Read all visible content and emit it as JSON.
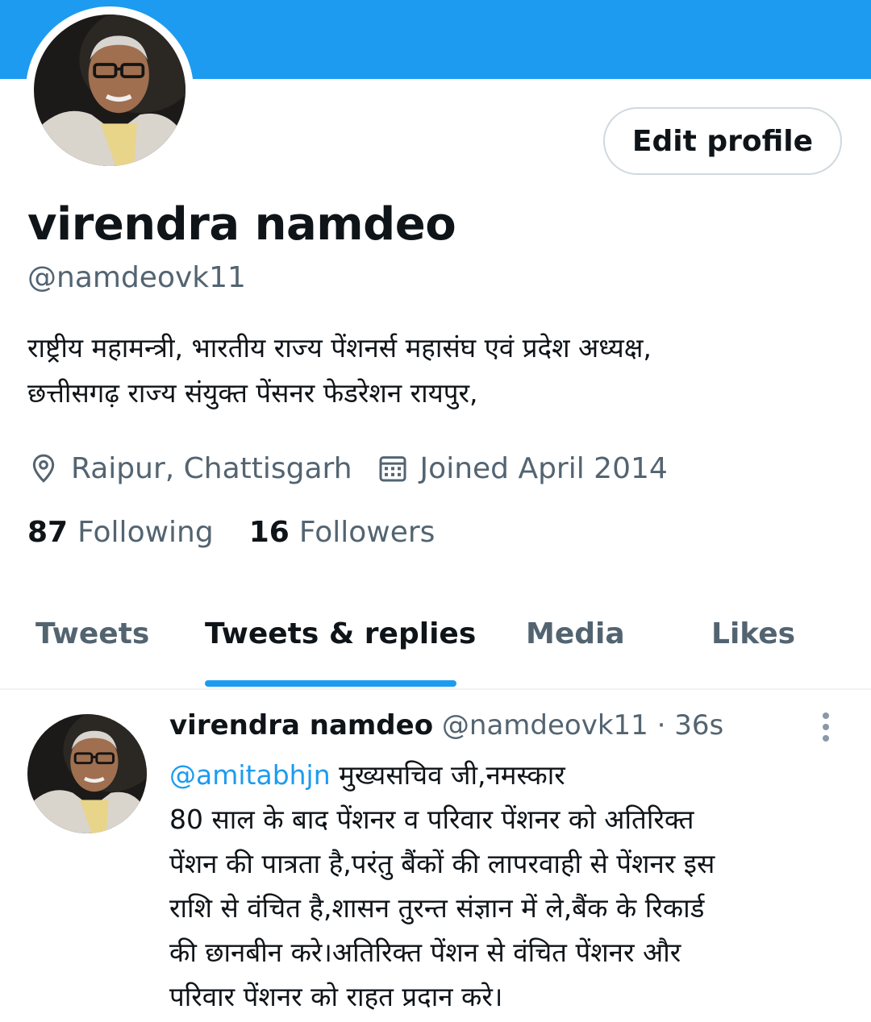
{
  "colors": {
    "accent": "#1d9bf0",
    "text_primary": "#0f1419",
    "text_secondary": "#536471",
    "border": "#cfd9de"
  },
  "profile": {
    "display_name": "virendra namdeo",
    "handle": "@namdeovk11",
    "edit_button_label": "Edit profile",
    "bio_lines": [
      "राष्ट्रीय महामन्त्री, भारतीय राज्य पेंशनर्स महासंघ  एवं प्रदेश अध्यक्ष,",
      "छत्तीसगढ़ राज्य संयुक्त पेंसनर फेडरेशन रायपुर,"
    ],
    "location_icon": "location-pin-icon",
    "location": "Raipur, Chattisgarh",
    "joined_icon": "calendar-icon",
    "joined": "Joined April 2014",
    "following_count": "87",
    "following_label": "Following",
    "followers_count": "16",
    "followers_label": "Followers"
  },
  "tabs": [
    {
      "label": "Tweets",
      "active": false
    },
    {
      "label": "Tweets & replies",
      "active": true
    },
    {
      "label": "Media",
      "active": false
    },
    {
      "label": "Likes",
      "active": false
    }
  ],
  "tweet": {
    "author_name": "virendra namdeo",
    "author_handle": "@namdeovk11",
    "separator": "·",
    "time": "36s",
    "more_icon": "more-vertical-icon",
    "mention": "@amitabhjn",
    "first_line_rest": " मुख्यसचिव जी,नमस्कार",
    "body_lines": [
      "80 साल के बाद पेंशनर व परिवार पेंशनर को अतिरिक्त",
      "पेंशन की पात्रता है,परंतु बैंकों की लापरवाही से पेंशनर इस",
      "राशि से वंचित है,शासन तुरन्त संज्ञान में ले,बैंक के रिकार्ड",
      "की छानबीन करे।अतिरिक्त पेंशन से वंचित पेंशनर और",
      "परिवार पेंशनर को राहत प्रदान करे।"
    ]
  }
}
